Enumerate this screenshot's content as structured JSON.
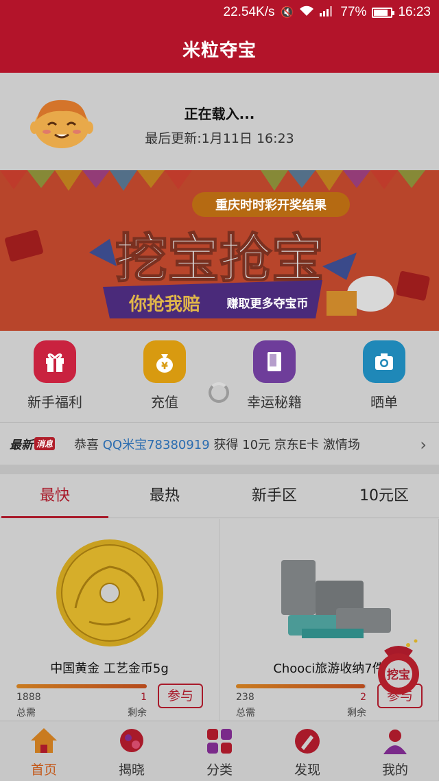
{
  "status_bar": {
    "speed": "22.54K/s",
    "battery": "77%",
    "battery_level": 0.77,
    "time": "16:23"
  },
  "app_title": "米粒夺宝",
  "refresh": {
    "title": "正在载入...",
    "subtitle": "最后更新:1月11日 16:23"
  },
  "banner": {
    "tag": "重庆时时彩开奖结果",
    "headline": "挖宝抢宝",
    "ribbon_main": "你抢我赔",
    "ribbon_sub": "赚取更多夺宝币"
  },
  "quick_actions": [
    {
      "label": "新手福利",
      "icon": "gift-icon",
      "color": "#c9223f"
    },
    {
      "label": "充值",
      "icon": "money-bag-icon",
      "color": "#d89a10"
    },
    {
      "label": "幸运秘籍",
      "icon": "book-icon",
      "color": "#6e3d9a"
    },
    {
      "label": "晒单",
      "icon": "camera-icon",
      "color": "#1f88b8"
    }
  ],
  "news": {
    "tag": "最新",
    "tag_badge": "消息",
    "prefix": "恭喜",
    "user": "QQ米宝78380919",
    "suffix": "获得 10元 京东E卡 激情场"
  },
  "tabs": [
    {
      "label": "最快",
      "active": true
    },
    {
      "label": "最热",
      "active": false
    },
    {
      "label": "新手区",
      "active": false
    },
    {
      "label": "10元区",
      "active": false
    }
  ],
  "products": [
    {
      "name": "中国黄金 工艺金币5g",
      "total": "1888",
      "total_label": "总需",
      "remaining": "1",
      "remaining_label": "剩余",
      "progress": 0.999,
      "join_label": "参与"
    },
    {
      "name": "Chooci旅游收纳7件",
      "total": "238",
      "total_label": "总需",
      "remaining": "2",
      "remaining_label": "剩余",
      "progress": 0.99,
      "join_label": "参与"
    }
  ],
  "floating_button": {
    "label": "挖宝"
  },
  "bottom_nav": [
    {
      "label": "首页",
      "icon": "home-icon",
      "active": true
    },
    {
      "label": "揭晓",
      "icon": "reveal-icon",
      "active": false
    },
    {
      "label": "分类",
      "icon": "category-icon",
      "active": false
    },
    {
      "label": "发现",
      "icon": "discover-icon",
      "active": false
    },
    {
      "label": "我的",
      "icon": "profile-icon",
      "active": false
    }
  ]
}
